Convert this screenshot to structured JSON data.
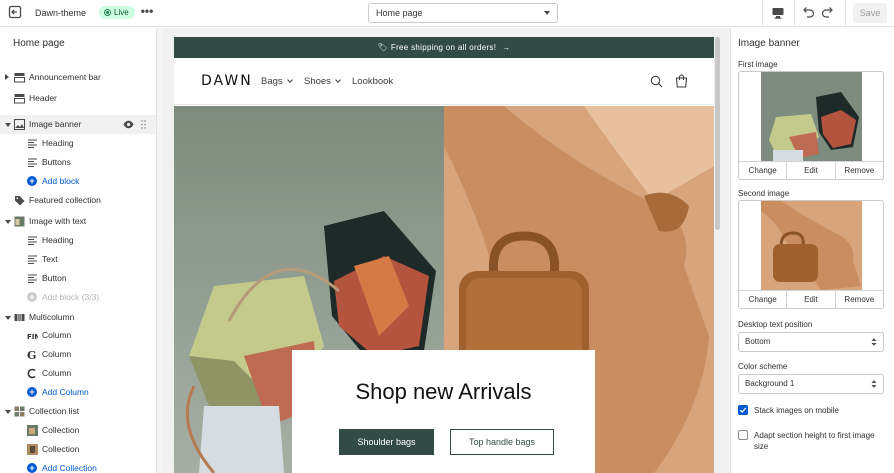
{
  "topbar": {
    "theme_name": "Dawn-theme",
    "status_badge": "Live",
    "page_selector": "Home page",
    "save_label": "Save"
  },
  "sidebar": {
    "title": "Home page",
    "items": [
      {
        "label": "Announcement bar"
      },
      {
        "label": "Header"
      },
      {
        "label": "Image banner"
      },
      {
        "label": "Heading"
      },
      {
        "label": "Buttons"
      },
      {
        "label": "Add block"
      },
      {
        "label": "Featured collection"
      },
      {
        "label": "Image with text"
      },
      {
        "label": "Heading"
      },
      {
        "label": "Text"
      },
      {
        "label": "Button"
      },
      {
        "label": "Add block (3/3)"
      },
      {
        "label": "Multicolumn"
      },
      {
        "label": "Column"
      },
      {
        "label": "Column"
      },
      {
        "label": "Column"
      },
      {
        "label": "Add Column"
      },
      {
        "label": "Collection list"
      },
      {
        "label": "Collection"
      },
      {
        "label": "Collection"
      },
      {
        "label": "Add Collection"
      }
    ]
  },
  "preview": {
    "announcement": "Free shipping on all orders!",
    "logo": "DAWN",
    "nav": [
      "Bags",
      "Shoes",
      "Lookbook"
    ],
    "banner_heading": "Shop new Arrivals",
    "button_primary": "Shoulder bags",
    "button_secondary": "Top handle bags"
  },
  "panel": {
    "title": "Image banner",
    "first_image_label": "First image",
    "second_image_label": "Second image",
    "image_actions": [
      "Change",
      "Edit",
      "Remove"
    ],
    "desktop_text_position_label": "Desktop text position",
    "desktop_text_position_value": "Bottom",
    "color_scheme_label": "Color scheme",
    "color_scheme_value": "Background 1",
    "stack_images_label": "Stack images on mobile",
    "stack_images_checked": true,
    "adapt_height_label": "Adapt section height to first image size",
    "adapt_height_checked": false
  },
  "colors": {
    "accent": "#005bd3",
    "announcement_bg": "#334b47",
    "live_badge_bg": "#cdfee1"
  }
}
